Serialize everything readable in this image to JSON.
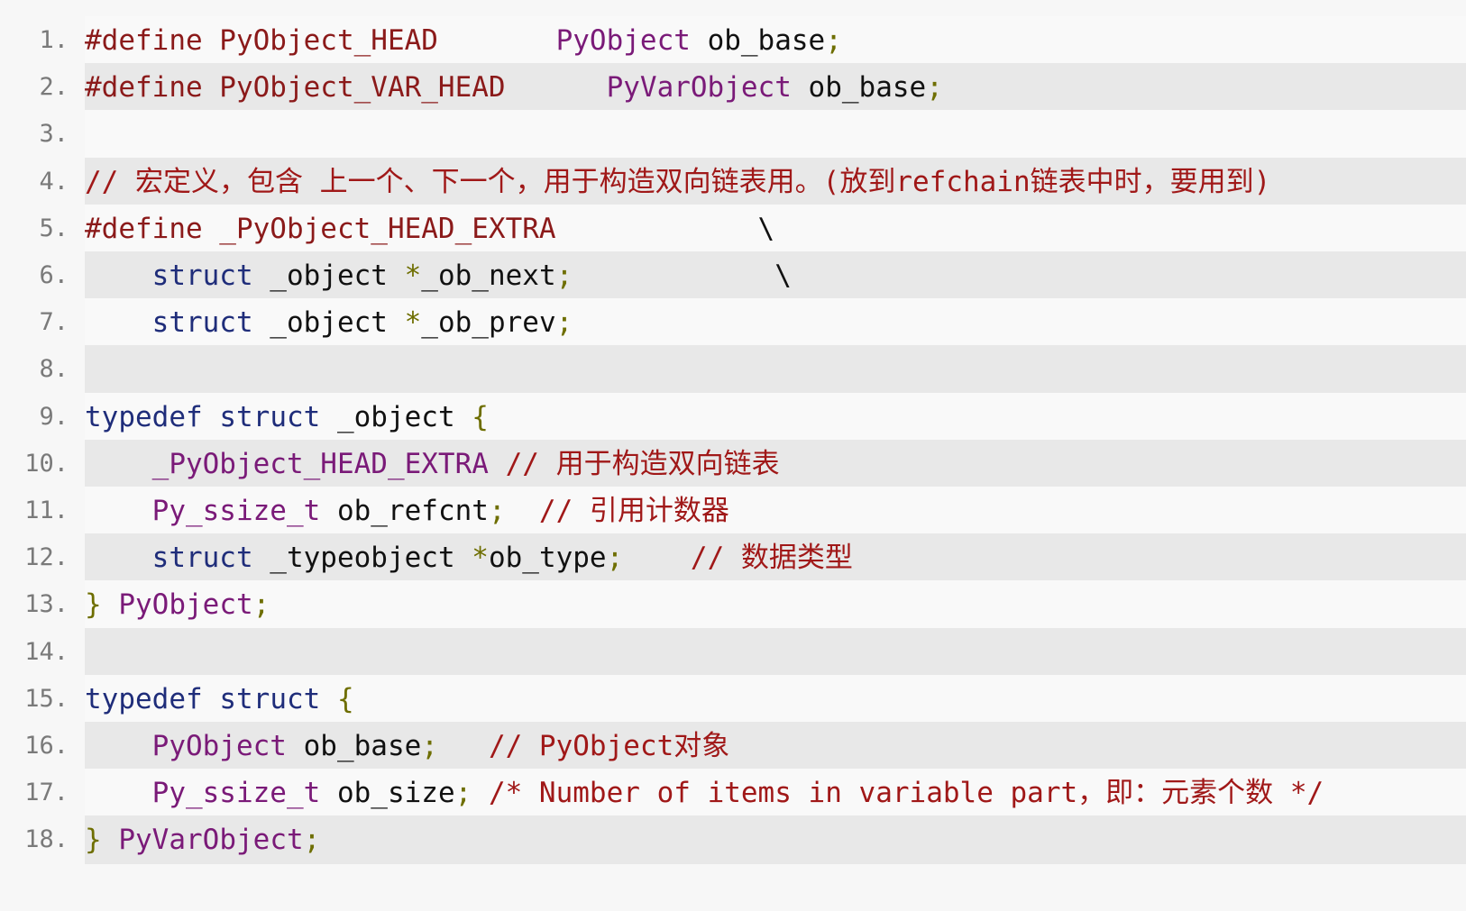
{
  "colors": {
    "background": "#f7f7f7",
    "stripe": "#e8e8e8",
    "line_number": "#7a7a7a",
    "preprocessor": "#8b1a1a",
    "keyword": "#1f2d7a",
    "type": "#7a1a78",
    "plain": "#111111",
    "comment": "#a01818",
    "punct": "#6e6e00"
  },
  "code": {
    "lines": [
      {
        "n": "1.",
        "tokens": [
          {
            "t": "#define PyObject_HEAD",
            "c": "preprocessor"
          },
          {
            "t": "       ",
            "c": "plain"
          },
          {
            "t": "PyObject",
            "c": "type"
          },
          {
            "t": " ob_base",
            "c": "plain"
          },
          {
            "t": ";",
            "c": "punct"
          }
        ]
      },
      {
        "n": "2.",
        "tokens": [
          {
            "t": "#define PyObject_VAR_HEAD",
            "c": "preprocessor"
          },
          {
            "t": "      ",
            "c": "plain"
          },
          {
            "t": "PyVarObject",
            "c": "type"
          },
          {
            "t": " ob_base",
            "c": "plain"
          },
          {
            "t": ";",
            "c": "punct"
          }
        ]
      },
      {
        "n": "3.",
        "tokens": []
      },
      {
        "n": "4.",
        "tokens": [
          {
            "t": "// 宏定义，包含 上一个、下一个，用于构造双向链表用。(放到refchain链表中时，要用到)",
            "c": "comment"
          }
        ]
      },
      {
        "n": "5.",
        "tokens": [
          {
            "t": "#define _PyObject_HEAD_EXTRA",
            "c": "preprocessor"
          },
          {
            "t": "            \\",
            "c": "plain"
          }
        ]
      },
      {
        "n": "6.",
        "tokens": [
          {
            "t": "    ",
            "c": "plain"
          },
          {
            "t": "struct",
            "c": "keyword"
          },
          {
            "t": " _object ",
            "c": "plain"
          },
          {
            "t": "*",
            "c": "punct"
          },
          {
            "t": "_ob_next",
            "c": "plain"
          },
          {
            "t": ";",
            "c": "punct"
          },
          {
            "t": "            \\",
            "c": "plain"
          }
        ]
      },
      {
        "n": "7.",
        "tokens": [
          {
            "t": "    ",
            "c": "plain"
          },
          {
            "t": "struct",
            "c": "keyword"
          },
          {
            "t": " _object ",
            "c": "plain"
          },
          {
            "t": "*",
            "c": "punct"
          },
          {
            "t": "_ob_prev",
            "c": "plain"
          },
          {
            "t": ";",
            "c": "punct"
          }
        ]
      },
      {
        "n": "8.",
        "tokens": []
      },
      {
        "n": "9.",
        "tokens": [
          {
            "t": "typedef",
            "c": "keyword"
          },
          {
            "t": " ",
            "c": "plain"
          },
          {
            "t": "struct",
            "c": "keyword"
          },
          {
            "t": " _object ",
            "c": "plain"
          },
          {
            "t": "{",
            "c": "punct"
          }
        ]
      },
      {
        "n": "10.",
        "tokens": [
          {
            "t": "    ",
            "c": "plain"
          },
          {
            "t": "_PyObject_HEAD_EXTRA",
            "c": "type"
          },
          {
            "t": " // 用于构造双向链表",
            "c": "comment"
          }
        ]
      },
      {
        "n": "11.",
        "tokens": [
          {
            "t": "    ",
            "c": "plain"
          },
          {
            "t": "Py_ssize_t",
            "c": "type"
          },
          {
            "t": " ob_refcnt",
            "c": "plain"
          },
          {
            "t": ";",
            "c": "punct"
          },
          {
            "t": "  // 引用计数器",
            "c": "comment"
          }
        ]
      },
      {
        "n": "12.",
        "tokens": [
          {
            "t": "    ",
            "c": "plain"
          },
          {
            "t": "struct",
            "c": "keyword"
          },
          {
            "t": " _typeobject ",
            "c": "plain"
          },
          {
            "t": "*",
            "c": "punct"
          },
          {
            "t": "ob_type",
            "c": "plain"
          },
          {
            "t": ";",
            "c": "punct"
          },
          {
            "t": "    // 数据类型",
            "c": "comment"
          }
        ]
      },
      {
        "n": "13.",
        "tokens": [
          {
            "t": "}",
            "c": "punct"
          },
          {
            "t": " ",
            "c": "plain"
          },
          {
            "t": "PyObject",
            "c": "type"
          },
          {
            "t": ";",
            "c": "punct"
          }
        ]
      },
      {
        "n": "14.",
        "tokens": []
      },
      {
        "n": "15.",
        "tokens": [
          {
            "t": "typedef",
            "c": "keyword"
          },
          {
            "t": " ",
            "c": "plain"
          },
          {
            "t": "struct",
            "c": "keyword"
          },
          {
            "t": " ",
            "c": "plain"
          },
          {
            "t": "{",
            "c": "punct"
          }
        ]
      },
      {
        "n": "16.",
        "tokens": [
          {
            "t": "    ",
            "c": "plain"
          },
          {
            "t": "PyObject",
            "c": "type"
          },
          {
            "t": " ob_base",
            "c": "plain"
          },
          {
            "t": ";",
            "c": "punct"
          },
          {
            "t": "   // PyObject对象",
            "c": "comment"
          }
        ]
      },
      {
        "n": "17.",
        "tokens": [
          {
            "t": "    ",
            "c": "plain"
          },
          {
            "t": "Py_ssize_t",
            "c": "type"
          },
          {
            "t": " ob_size",
            "c": "plain"
          },
          {
            "t": ";",
            "c": "punct"
          },
          {
            "t": " /* Number of items in variable part，即：元素个数 */",
            "c": "comment"
          }
        ]
      },
      {
        "n": "18.",
        "tokens": [
          {
            "t": "}",
            "c": "punct"
          },
          {
            "t": " ",
            "c": "plain"
          },
          {
            "t": "PyVarObject",
            "c": "type"
          },
          {
            "t": ";",
            "c": "punct"
          }
        ]
      }
    ]
  }
}
